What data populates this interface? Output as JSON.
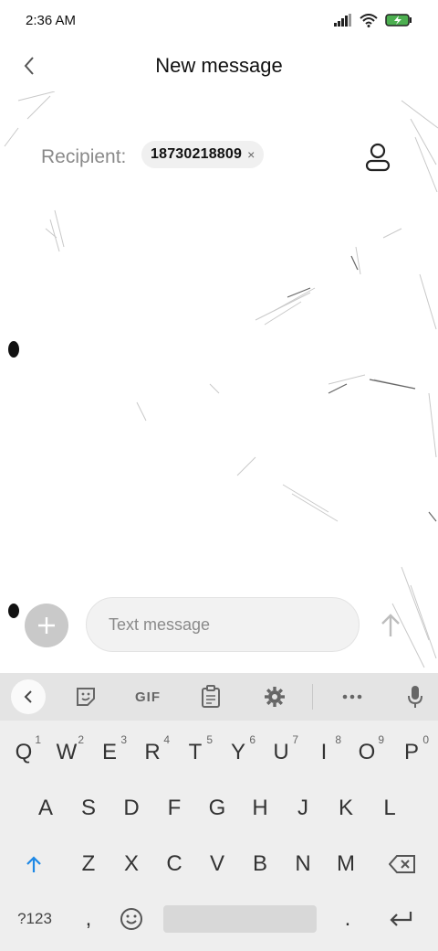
{
  "status": {
    "time": "2:36 AM"
  },
  "header": {
    "title": "New message"
  },
  "recipient": {
    "label": "Recipient:",
    "chip": "18730218809",
    "chip_close": "×"
  },
  "compose": {
    "placeholder": "Text message"
  },
  "keyboard": {
    "toolbar": {
      "gif": "GIF"
    },
    "row1": [
      {
        "k": "Q",
        "h": "1"
      },
      {
        "k": "W",
        "h": "2"
      },
      {
        "k": "E",
        "h": "3"
      },
      {
        "k": "R",
        "h": "4"
      },
      {
        "k": "T",
        "h": "5"
      },
      {
        "k": "Y",
        "h": "6"
      },
      {
        "k": "U",
        "h": "7"
      },
      {
        "k": "I",
        "h": "8"
      },
      {
        "k": "O",
        "h": "9"
      },
      {
        "k": "P",
        "h": "0"
      }
    ],
    "row2": [
      "A",
      "S",
      "D",
      "F",
      "G",
      "H",
      "J",
      "K",
      "L"
    ],
    "row3": [
      "Z",
      "X",
      "C",
      "V",
      "B",
      "N",
      "M"
    ],
    "row4": {
      "sym": "?123",
      "comma": ",",
      "period": "."
    }
  },
  "colors": {
    "accent": "#1e88e5",
    "keyboard_bg": "#eeeeee",
    "toolbar_bg": "#e4e4e4"
  }
}
